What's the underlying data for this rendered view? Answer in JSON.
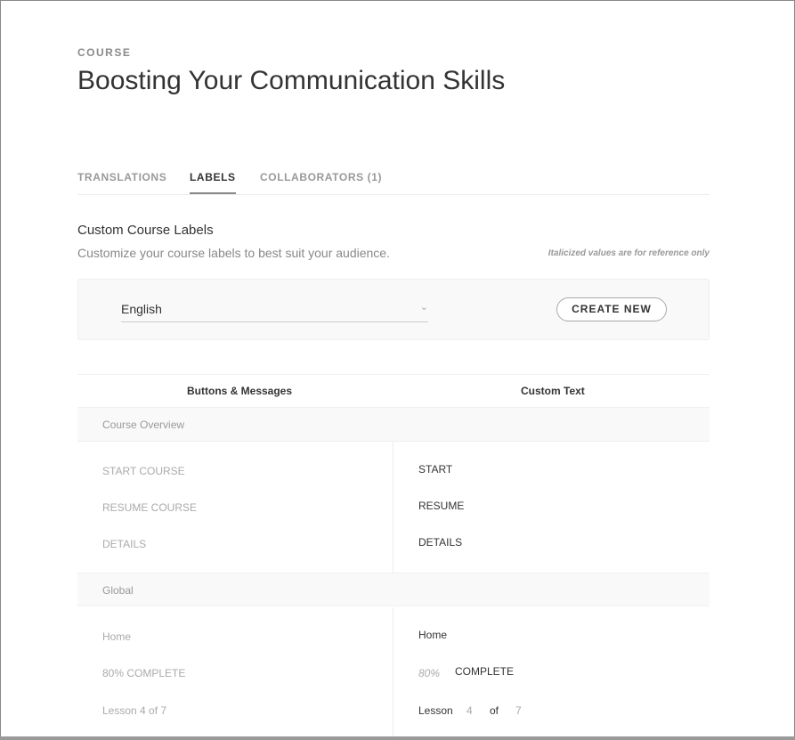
{
  "header": {
    "eyebrow": "COURSE",
    "title": "Boosting Your Communication Skills"
  },
  "tabs": [
    {
      "label": "TRANSLATIONS"
    },
    {
      "label": "LABELS"
    },
    {
      "label": "COLLABORATORS (1)"
    }
  ],
  "section": {
    "title": "Custom Course Labels",
    "subtitle": "Customize your course labels to best suit your audience.",
    "note": "Italicized values are for reference only"
  },
  "toolbar": {
    "language": "English",
    "create_label": "CREATE NEW"
  },
  "table": {
    "col1": "Buttons & Messages",
    "col2": "Custom Text"
  },
  "groups": [
    {
      "name": "Course Overview",
      "rows": [
        {
          "label": "START COURSE",
          "value": "START"
        },
        {
          "label": "RESUME COURSE",
          "value": "RESUME"
        },
        {
          "label": "DETAILS",
          "value": "DETAILS"
        }
      ]
    },
    {
      "name": "Global",
      "rows": [
        {
          "label": "Home",
          "value": "Home"
        },
        {
          "label": "80% COMPLETE",
          "ref": "80%",
          "value": "COMPLETE"
        },
        {
          "label": "Lesson 4 of 7",
          "parts": [
            "Lesson",
            "4",
            "of",
            "7"
          ]
        }
      ]
    }
  ]
}
